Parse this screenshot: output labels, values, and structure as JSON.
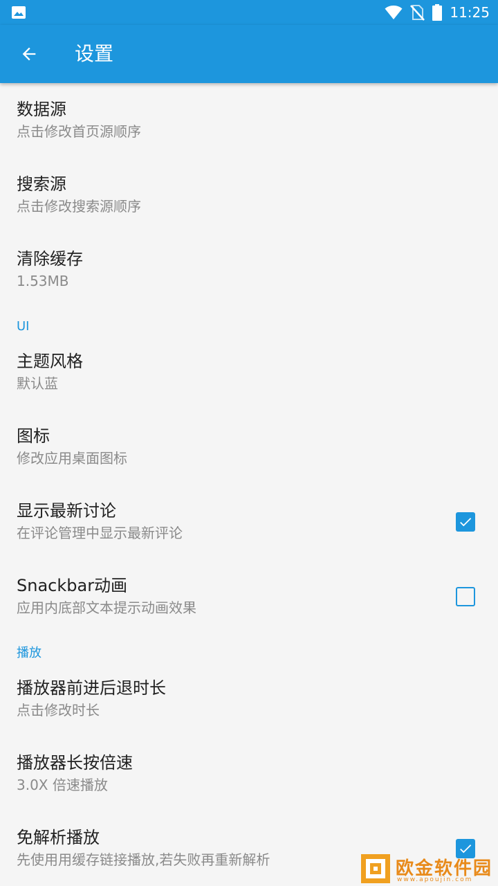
{
  "status_bar": {
    "time": "11:25",
    "icons": [
      "gallery-icon",
      "wifi-icon",
      "no-sim-icon",
      "battery-icon"
    ]
  },
  "app_bar": {
    "title": "设置",
    "back_icon": "arrow-back-icon"
  },
  "colors": {
    "primary": "#1d96dd",
    "background": "#f5f5f5",
    "title_text": "#212121",
    "summary_text": "#8a8a8a"
  },
  "preferences": {
    "data_source": {
      "title": "数据源",
      "summary": "点击修改首页源顺序"
    },
    "search_source": {
      "title": "搜索源",
      "summary": "点击修改搜索源顺序"
    },
    "clear_cache": {
      "title": "清除缓存",
      "summary": "1.53MB"
    },
    "ui_category": "UI",
    "theme": {
      "title": "主题风格",
      "summary": "默认蓝"
    },
    "icon": {
      "title": "图标",
      "summary": "修改应用桌面图标"
    },
    "show_latest": {
      "title": "显示最新讨论",
      "summary": "在评论管理中显示最新评论",
      "checked": true
    },
    "snackbar": {
      "title": "Snackbar动画",
      "summary": "应用内底部文本提示动画效果",
      "checked": false
    },
    "play_category": "播放",
    "seek_duration": {
      "title": "播放器前进后退时长",
      "summary": "点击修改时长"
    },
    "long_press_speed": {
      "title": "播放器长按倍速",
      "summary": "3.0X 倍速播放"
    },
    "no_parse": {
      "title": "免解析播放",
      "summary": "先使用用缓存链接播放,若失败再重新解析",
      "checked": true
    }
  },
  "watermark": {
    "text": "欧金软件园",
    "url": "www.apoujin.com"
  }
}
